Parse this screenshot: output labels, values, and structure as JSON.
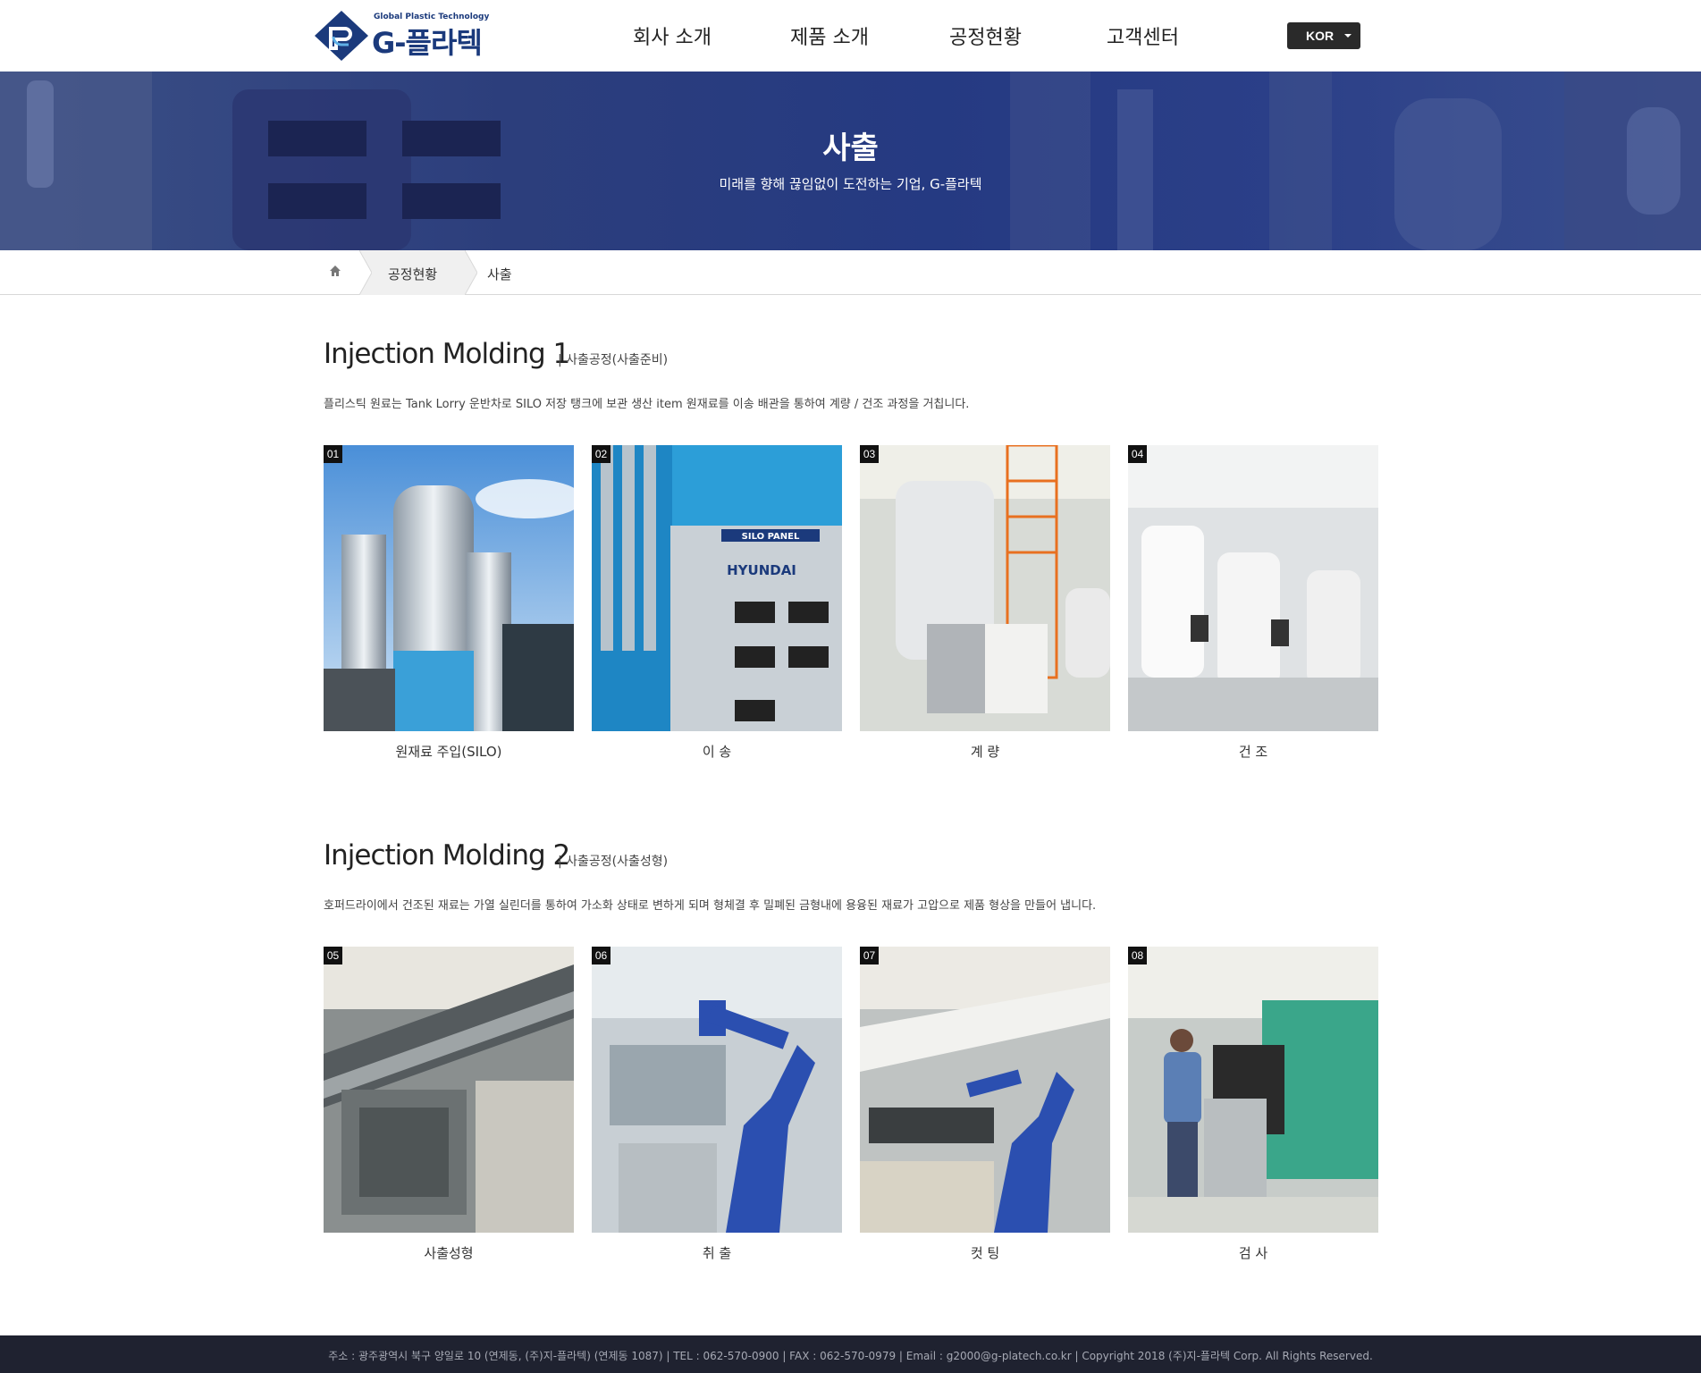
{
  "header": {
    "logo_tagline": "Global Plastic Technology",
    "logo_name": "G-플라텍",
    "nav": [
      "회사 소개",
      "제품 소개",
      "공정현황",
      "고객센터"
    ],
    "language": "KOR",
    "brand_color": "#1b3a7c"
  },
  "banner": {
    "title": "사출",
    "subtitle": "미래를 향해 끊임없이 도전하는 기업, G-플라텍"
  },
  "breadcrumb": {
    "home_icon": "home-icon",
    "level1": "공정현황",
    "current": "사출"
  },
  "sections": [
    {
      "title": "Injection Molding 1",
      "subtitle": "| 사출공정(사출준비)",
      "description": "플리스틱 원료는 Tank Lorry 운반차로 SILO 저장 탱크에 보관 생산 item 원재료를 이송 배관을 통하여 계량 / 건조 과정을 거칩니다.",
      "items": [
        {
          "num": "01",
          "caption": "원재료 주입(SILO)",
          "panel_label": ""
        },
        {
          "num": "02",
          "caption": "이 송",
          "panel_label": "SILO PANEL",
          "panel_brand": "HYUNDAI"
        },
        {
          "num": "03",
          "caption": "계 량",
          "panel_label": ""
        },
        {
          "num": "04",
          "caption": "건 조",
          "panel_label": ""
        }
      ]
    },
    {
      "title": "Injection Molding 2",
      "subtitle": "| 사출공정(사출성형)",
      "description": "호퍼드라이에서 건조된 재료는 가열 실린더를 통하여 가소화 상태로 변하게 되며 형체결 후 밀폐된 금형내에 용융된 재료가 고압으로 제품 형상을 만들어 냅니다.",
      "items": [
        {
          "num": "05",
          "caption": "사출성형"
        },
        {
          "num": "06",
          "caption": "취 출"
        },
        {
          "num": "07",
          "caption": "컷 팅"
        },
        {
          "num": "08",
          "caption": "검 사"
        }
      ]
    }
  ],
  "footer": {
    "text": "주소 : 광주광역시 북구 양일로 10 (연제동, (주)지-플라텍) (연제동 1087) | TEL : 062-570-0900 | FAX : 062-570-0979 | Email : g2000@g-platech.co.kr | Copyright 2018 (주)지-플라텍 Corp. All Rights Reserved."
  }
}
